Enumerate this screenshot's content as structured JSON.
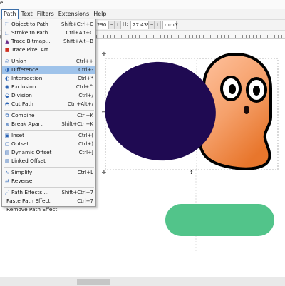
{
  "colors": {
    "menu_highlight": "#9fc3ea",
    "ellipse_fill": "#1f0a52",
    "pill_fill": "#52c48a",
    "face_peach_light": "#ffc3a0",
    "face_peach_dark": "#e8762c",
    "outline": "#000000"
  },
  "menubar": {
    "items": [
      {
        "label": "Path"
      },
      {
        "label": "Text"
      },
      {
        "label": "Filters"
      },
      {
        "label": "Extensions"
      },
      {
        "label": "Help"
      }
    ]
  },
  "top_sliver": {
    "text": "e"
  },
  "controls": {
    "x_value": "290",
    "h_label": "H:",
    "h_value": "27.439",
    "unit": "mm"
  },
  "path_menu": {
    "items": [
      {
        "label": "Object to Path",
        "shortcut": "Shift+Ctrl+C",
        "icon": "object-to-path-icon"
      },
      {
        "label": "Stroke to Path",
        "shortcut": "Ctrl+Alt+C",
        "icon": "stroke-to-path-icon"
      },
      {
        "label": "Trace Bitmap...",
        "shortcut": "Shift+Alt+B",
        "icon": "trace-bitmap-icon"
      },
      {
        "label": "Trace Pixel Art...",
        "shortcut": "",
        "icon": "trace-pixel-art-icon"
      },
      {
        "label": "Union",
        "shortcut": "Ctrl++",
        "icon": "union-icon"
      },
      {
        "label": "Difference",
        "shortcut": "Ctrl+-",
        "icon": "difference-icon"
      },
      {
        "label": "Intersection",
        "shortcut": "Ctrl+*",
        "icon": "intersection-icon"
      },
      {
        "label": "Exclusion",
        "shortcut": "Ctrl+^",
        "icon": "exclusion-icon"
      },
      {
        "label": "Division",
        "shortcut": "Ctrl+/",
        "icon": "division-icon"
      },
      {
        "label": "Cut Path",
        "shortcut": "Ctrl+Alt+/",
        "icon": "cut-path-icon"
      },
      {
        "label": "Combine",
        "shortcut": "Ctrl+K",
        "icon": "combine-icon"
      },
      {
        "label": "Break Apart",
        "shortcut": "Shift+Ctrl+K",
        "icon": "break-apart-icon"
      },
      {
        "label": "Inset",
        "shortcut": "Ctrl+(",
        "icon": "inset-icon"
      },
      {
        "label": "Outset",
        "shortcut": "Ctrl+)",
        "icon": "outset-icon"
      },
      {
        "label": "Dynamic Offset",
        "shortcut": "Ctrl+J",
        "icon": "dynamic-offset-icon"
      },
      {
        "label": "Linked Offset",
        "shortcut": "",
        "icon": "linked-offset-icon"
      },
      {
        "label": "Simplify",
        "shortcut": "Ctrl+L",
        "icon": "simplify-icon"
      },
      {
        "label": "Reverse",
        "shortcut": "",
        "icon": "reverse-icon"
      },
      {
        "label": "Path Effects ...",
        "shortcut": "Shift+Ctrl+7",
        "icon": "path-effects-icon"
      },
      {
        "label": "Paste Path Effect",
        "shortcut": "Ctrl+7",
        "icon": ""
      },
      {
        "label": "Remove Path Effect",
        "shortcut": "",
        "icon": ""
      }
    ],
    "highlighted": "Difference"
  }
}
